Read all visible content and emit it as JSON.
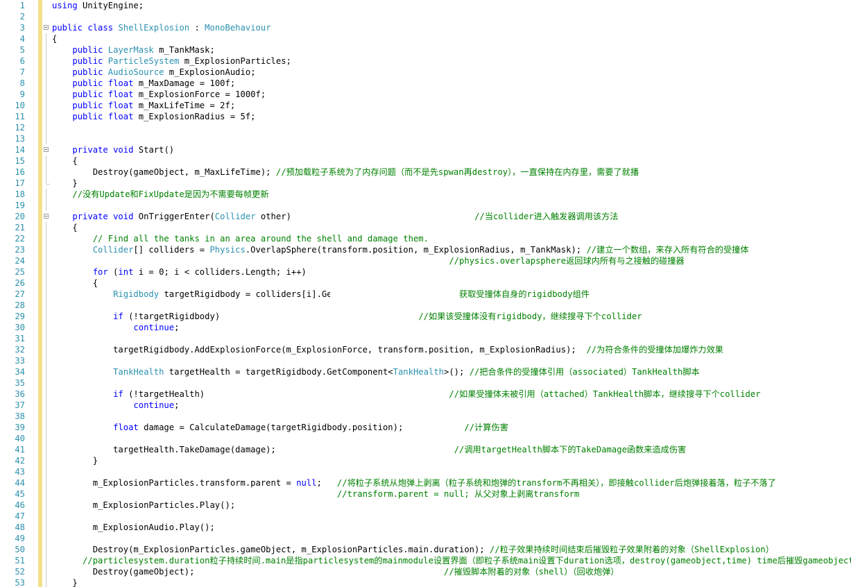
{
  "colors": {
    "keyword": "#0000ff",
    "type": "#2b91af",
    "comment": "#008000",
    "line_number": "#2b91af",
    "change_marker": "#f3e08a"
  },
  "lines": [
    {
      "n": "1",
      "indent": 0,
      "fold": "none",
      "tokens": [
        [
          "k",
          "using"
        ],
        [
          "p",
          " UnityEngine;"
        ]
      ]
    },
    {
      "n": "2",
      "indent": 0,
      "fold": "none",
      "tokens": []
    },
    {
      "n": "3",
      "indent": 0,
      "fold": "start",
      "tokens": [
        [
          "k",
          "public"
        ],
        [
          "p",
          " "
        ],
        [
          "k",
          "class"
        ],
        [
          "p",
          " "
        ],
        [
          "t",
          "ShellExplosion"
        ],
        [
          "p",
          " : "
        ],
        [
          "t",
          "MonoBehaviour"
        ]
      ]
    },
    {
      "n": "4",
      "indent": 0,
      "fold": "line",
      "tokens": [
        [
          "p",
          "{"
        ]
      ]
    },
    {
      "n": "5",
      "indent": 4,
      "fold": "line",
      "tokens": [
        [
          "k",
          "public"
        ],
        [
          "p",
          " "
        ],
        [
          "t",
          "LayerMask"
        ],
        [
          "p",
          " m_TankMask;"
        ]
      ]
    },
    {
      "n": "6",
      "indent": 4,
      "fold": "line",
      "tokens": [
        [
          "k",
          "public"
        ],
        [
          "p",
          " "
        ],
        [
          "t",
          "ParticleSystem"
        ],
        [
          "p",
          " m_ExplosionParticles;"
        ]
      ]
    },
    {
      "n": "7",
      "indent": 4,
      "fold": "line",
      "tokens": [
        [
          "k",
          "public"
        ],
        [
          "p",
          " "
        ],
        [
          "t",
          "AudioSource"
        ],
        [
          "p",
          " m_ExplosionAudio;"
        ]
      ]
    },
    {
      "n": "8",
      "indent": 4,
      "fold": "line",
      "tokens": [
        [
          "k",
          "public"
        ],
        [
          "p",
          " "
        ],
        [
          "k",
          "float"
        ],
        [
          "p",
          " m_MaxDamage = 100f;"
        ]
      ]
    },
    {
      "n": "9",
      "indent": 4,
      "fold": "line",
      "tokens": [
        [
          "k",
          "public"
        ],
        [
          "p",
          " "
        ],
        [
          "k",
          "float"
        ],
        [
          "p",
          " m_ExplosionForce = 1000f;"
        ]
      ]
    },
    {
      "n": "10",
      "indent": 4,
      "fold": "line",
      "tokens": [
        [
          "k",
          "public"
        ],
        [
          "p",
          " "
        ],
        [
          "k",
          "float"
        ],
        [
          "p",
          " m_MaxLifeTime = 2f;"
        ]
      ]
    },
    {
      "n": "11",
      "indent": 4,
      "fold": "line",
      "tokens": [
        [
          "k",
          "public"
        ],
        [
          "p",
          " "
        ],
        [
          "k",
          "float"
        ],
        [
          "p",
          " m_ExplosionRadius = 5f;"
        ]
      ]
    },
    {
      "n": "12",
      "indent": 0,
      "fold": "line",
      "tokens": []
    },
    {
      "n": "13",
      "indent": 0,
      "fold": "line",
      "tokens": []
    },
    {
      "n": "14",
      "indent": 4,
      "fold": "start",
      "tokens": [
        [
          "k",
          "private"
        ],
        [
          "p",
          " "
        ],
        [
          "k",
          "void"
        ],
        [
          "p",
          " Start()"
        ]
      ]
    },
    {
      "n": "15",
      "indent": 4,
      "fold": "line",
      "tokens": [
        [
          "p",
          "{"
        ]
      ]
    },
    {
      "n": "16",
      "indent": 8,
      "fold": "line",
      "tokens": [
        [
          "p",
          "Destroy(gameObject, m_MaxLifeTime); "
        ],
        [
          "c",
          "//预加载粒子系统为了内存问题（而不是先spwan再destroy），一直保持在内存里，需要了就播"
        ]
      ]
    },
    {
      "n": "17",
      "indent": 4,
      "fold": "end",
      "tokens": [
        [
          "p",
          "}"
        ]
      ]
    },
    {
      "n": "18",
      "indent": 4,
      "fold": "line",
      "tokens": [
        [
          "c",
          "//没有Update和FixUpdate是因为不需要每帧更新"
        ]
      ]
    },
    {
      "n": "19",
      "indent": 0,
      "fold": "line",
      "tokens": []
    },
    {
      "n": "20",
      "indent": 4,
      "fold": "start",
      "tokens": [
        [
          "k",
          "private"
        ],
        [
          "p",
          " "
        ],
        [
          "k",
          "void"
        ],
        [
          "p",
          " OnTriggerEnter("
        ],
        [
          "t",
          "Collider"
        ],
        [
          "p",
          " other)                                    "
        ],
        [
          "c",
          "//当collider进入触发器调用该方法"
        ]
      ]
    },
    {
      "n": "21",
      "indent": 4,
      "fold": "line",
      "tokens": [
        [
          "p",
          "{"
        ]
      ]
    },
    {
      "n": "22",
      "indent": 8,
      "fold": "line",
      "tokens": [
        [
          "c",
          "// Find all the tanks in an area around the shell and damage them."
        ]
      ]
    },
    {
      "n": "23",
      "indent": 8,
      "fold": "line",
      "tokens": [
        [
          "t",
          "Collider"
        ],
        [
          "p",
          "[] colliders = "
        ],
        [
          "t",
          "Physics"
        ],
        [
          "p",
          ".OverlapSphere(transform.position, m_ExplosionRadius, m_TankMask); "
        ],
        [
          "c",
          "//建立一个数组，来存入所有符合的受撞体"
        ]
      ]
    },
    {
      "n": "24",
      "indent": 78,
      "fold": "line",
      "tokens": [
        [
          "c",
          "//physics.overlapsphere返回球内所有与之接触的碰撞器"
        ]
      ]
    },
    {
      "n": "25",
      "indent": 8,
      "fold": "line",
      "tokens": [
        [
          "k",
          "for"
        ],
        [
          "p",
          " ("
        ],
        [
          "k",
          "int"
        ],
        [
          "p",
          " i = 0; i < colliders.Length; i++)"
        ]
      ]
    },
    {
      "n": "26",
      "indent": 8,
      "fold": "line",
      "tokens": [
        [
          "p",
          "{"
        ]
      ]
    },
    {
      "n": "27",
      "indent": 12,
      "fold": "line",
      "tokens": [
        [
          "t",
          "Rigidbody"
        ],
        [
          "p",
          " targetRigidbody = colliders[i].Ge"
        ],
        [
          "p",
          "                         "
        ],
        [
          "c",
          "获取受撞体自身的rigidbody组件"
        ]
      ]
    },
    {
      "n": "28",
      "indent": 0,
      "fold": "line",
      "tokens": []
    },
    {
      "n": "29",
      "indent": 12,
      "fold": "line",
      "tokens": [
        [
          "k",
          "if"
        ],
        [
          "p",
          " (!targetRigidbody)                                       "
        ],
        [
          "c",
          "//如果该受撞体没有rigidbody，继续搜寻下个collider"
        ]
      ]
    },
    {
      "n": "30",
      "indent": 16,
      "fold": "line",
      "tokens": [
        [
          "k",
          "continue"
        ],
        [
          "p",
          ";"
        ]
      ]
    },
    {
      "n": "31",
      "indent": 0,
      "fold": "line",
      "tokens": []
    },
    {
      "n": "32",
      "indent": 12,
      "fold": "line",
      "tokens": [
        [
          "p",
          "targetRigidbody.AddExplosionForce(m_ExplosionForce, transform.position, m_ExplosionRadius);  "
        ],
        [
          "c",
          "//为符合条件的受撞体加爆炸力效果"
        ]
      ]
    },
    {
      "n": "33",
      "indent": 0,
      "fold": "line",
      "tokens": []
    },
    {
      "n": "34",
      "indent": 12,
      "fold": "line",
      "tokens": [
        [
          "t",
          "TankHealth"
        ],
        [
          "p",
          " targetHealth = targetRigidbody.GetComponent<"
        ],
        [
          "t",
          "TankHealth"
        ],
        [
          "p",
          ">(); "
        ],
        [
          "c",
          "//把合条件的受撞体引用（associated）TankHealth脚本"
        ]
      ]
    },
    {
      "n": "35",
      "indent": 0,
      "fold": "line",
      "tokens": []
    },
    {
      "n": "36",
      "indent": 12,
      "fold": "line",
      "tokens": [
        [
          "k",
          "if"
        ],
        [
          "p",
          " (!targetHealth)                                                "
        ],
        [
          "c",
          "//如果受撞体未被引用（attached）TankHealth脚本，继续搜寻下个collider"
        ]
      ]
    },
    {
      "n": "37",
      "indent": 16,
      "fold": "line",
      "tokens": [
        [
          "k",
          "continue"
        ],
        [
          "p",
          ";"
        ]
      ]
    },
    {
      "n": "38",
      "indent": 0,
      "fold": "line",
      "tokens": []
    },
    {
      "n": "39",
      "indent": 12,
      "fold": "line",
      "tokens": [
        [
          "k",
          "float"
        ],
        [
          "p",
          " damage = CalculateDamage(targetRigidbody.position);            "
        ],
        [
          "c",
          "//计算伤害"
        ]
      ]
    },
    {
      "n": "40",
      "indent": 0,
      "fold": "line",
      "tokens": []
    },
    {
      "n": "41",
      "indent": 12,
      "fold": "line",
      "tokens": [
        [
          "p",
          "targetHealth.TakeDamage(damage);                                   "
        ],
        [
          "c",
          "//调用targetHealth脚本下的TakeDamage函数来造成伤害"
        ]
      ]
    },
    {
      "n": "42",
      "indent": 8,
      "fold": "line",
      "tokens": [
        [
          "p",
          "}"
        ]
      ]
    },
    {
      "n": "43",
      "indent": 0,
      "fold": "line",
      "tokens": []
    },
    {
      "n": "44",
      "indent": 8,
      "fold": "line",
      "tokens": [
        [
          "p",
          "m_ExplosionParticles.transform.parent = "
        ],
        [
          "k",
          "null"
        ],
        [
          "p",
          ";   "
        ],
        [
          "c",
          "//将粒子系统从炮弹上剥离（粒子系统和炮弹的transform不再相关），即接触collider后炮弹接着落，粒子不落了"
        ]
      ]
    },
    {
      "n": "45",
      "indent": 56,
      "fold": "line",
      "tokens": [
        [
          "c",
          "//transform.parent = null; 从父对象上剥离transform"
        ]
      ]
    },
    {
      "n": "46",
      "indent": 8,
      "fold": "line",
      "tokens": [
        [
          "p",
          "m_ExplosionParticles.Play();"
        ]
      ]
    },
    {
      "n": "47",
      "indent": 0,
      "fold": "line",
      "tokens": []
    },
    {
      "n": "48",
      "indent": 8,
      "fold": "line",
      "tokens": [
        [
          "p",
          "m_ExplosionAudio.Play();"
        ]
      ]
    },
    {
      "n": "49",
      "indent": 0,
      "fold": "line",
      "tokens": []
    },
    {
      "n": "50",
      "indent": 8,
      "fold": "line",
      "tokens": [
        [
          "p",
          "Destroy(m_ExplosionParticles.gameObject, m_ExplosionParticles.main.duration); "
        ],
        [
          "c",
          "//粒子效果持续时间结束后摧毁粒子效果附着的对象（ShellExplosion）"
        ]
      ]
    },
    {
      "n": "51",
      "indent": 6,
      "fold": "line",
      "tokens": [
        [
          "c",
          "//particlesystem.duration粒子持续时间.main是指particlesystem的mainmodule设置界面（即粒子系统main设置下duration选项，destroy(gameobject,time) time后摧毁gameobject."
        ]
      ]
    },
    {
      "n": "52",
      "indent": 8,
      "fold": "line",
      "tokens": [
        [
          "p",
          "Destroy(gameObject);                                                 "
        ],
        [
          "c",
          "//摧毁脚本附着的对象（shell）（回收炮弹）"
        ]
      ]
    },
    {
      "n": "53",
      "indent": 4,
      "fold": "line",
      "tokens": [
        [
          "p",
          "}"
        ]
      ]
    }
  ]
}
